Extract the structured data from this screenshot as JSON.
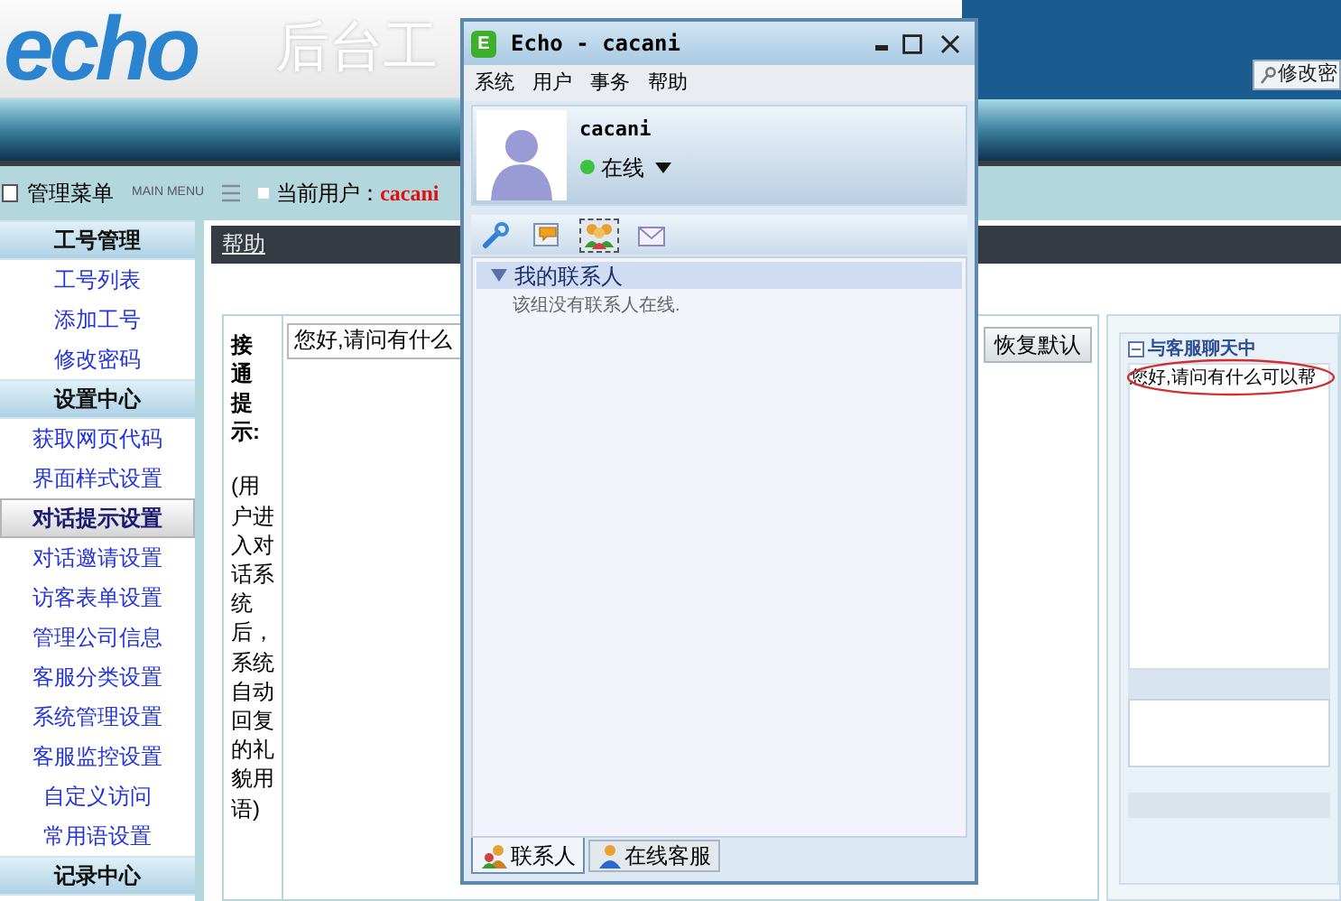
{
  "header": {
    "logo": "echo",
    "title": "后台工",
    "password_button": "修改密"
  },
  "topbar": {
    "menu_title": "管理菜单",
    "menu_subtitle": "MAIN MENU",
    "user_label": "当前用户：",
    "user_name": "cacani"
  },
  "sidebar": {
    "groups": [
      {
        "title": "工号管理",
        "items": [
          {
            "label": "工号列表",
            "selected": false
          },
          {
            "label": "添加工号",
            "selected": false
          },
          {
            "label": "修改密码",
            "selected": false
          }
        ]
      },
      {
        "title": "设置中心",
        "items": [
          {
            "label": "获取网页代码",
            "selected": false
          },
          {
            "label": "界面样式设置",
            "selected": false
          },
          {
            "label": "对话提示设置",
            "selected": true
          },
          {
            "label": "对话邀请设置",
            "selected": false
          },
          {
            "label": "访客表单设置",
            "selected": false
          },
          {
            "label": "管理公司信息",
            "selected": false
          },
          {
            "label": "客服分类设置",
            "selected": false
          },
          {
            "label": "系统管理设置",
            "selected": false
          },
          {
            "label": "客服监控设置",
            "selected": false
          },
          {
            "label": "自定义访问",
            "selected": false
          },
          {
            "label": "常用语设置",
            "selected": false
          }
        ]
      },
      {
        "title": "记录中心"
      }
    ]
  },
  "content": {
    "breadcrumb": "帮助",
    "form": {
      "label": "接通提示:",
      "hint": "(用户进入对话系统后，系统自动回复的礼貌用语)",
      "value": "您好,请问有什么",
      "reset_button": "恢复默认"
    },
    "preview": {
      "title": "与客服聊天中",
      "message": "您好,请问有什么可以帮"
    }
  },
  "chat_window": {
    "icon_letter": "E",
    "title": "Echo - cacani",
    "menu": [
      "系统",
      "用户",
      "事务",
      "帮助"
    ],
    "user": {
      "name": "cacani",
      "status": "在线"
    },
    "toolbar": [
      {
        "kind": "settings",
        "selected": false
      },
      {
        "kind": "chat",
        "selected": false
      },
      {
        "kind": "contacts",
        "selected": true
      },
      {
        "kind": "mail",
        "selected": false
      }
    ],
    "groups": [
      {
        "name": "我的联系人",
        "expanded": true,
        "empty_text": "该组没有联系人在线."
      }
    ],
    "tabs": [
      {
        "label": "联系人",
        "kind": "contacts",
        "selected": true
      },
      {
        "label": "在线客服",
        "kind": "agent",
        "selected": false
      }
    ]
  }
}
